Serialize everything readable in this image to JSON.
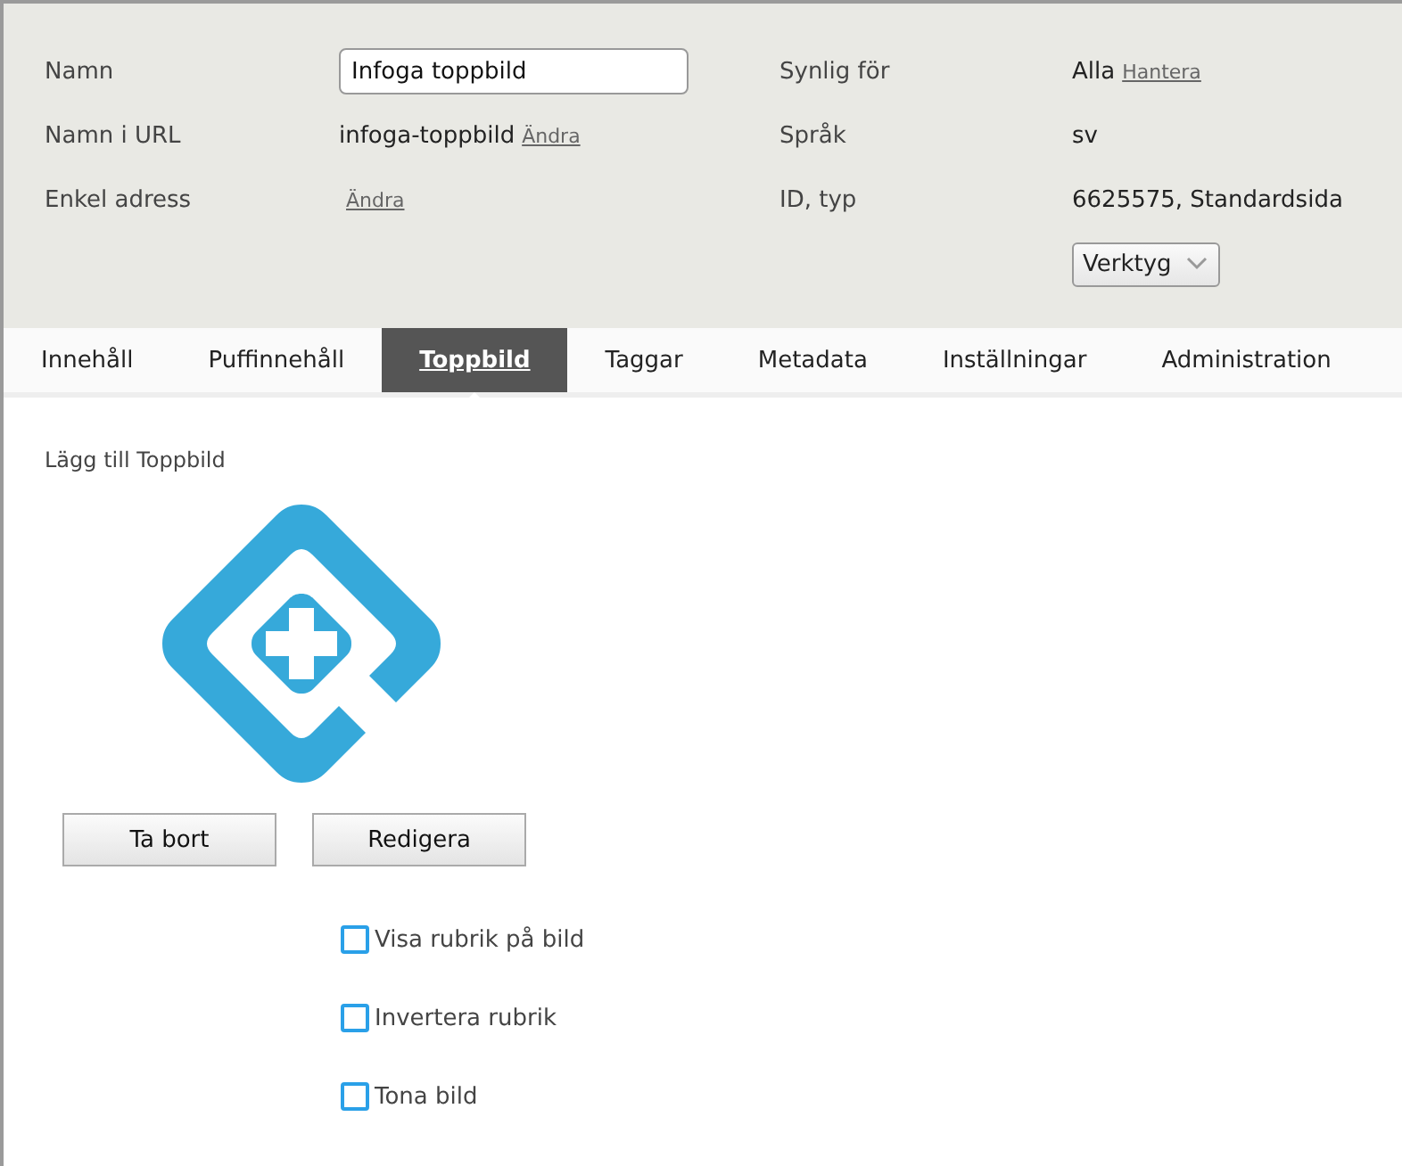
{
  "properties": {
    "left": [
      {
        "label": "Namn",
        "kind": "input",
        "value": "Infoga toppbild"
      },
      {
        "label": "Namn i URL",
        "kind": "text",
        "value": "infoga-toppbild",
        "link": "Ändra"
      },
      {
        "label": "Enkel adress",
        "kind": "link",
        "link": "Ändra"
      }
    ],
    "right": [
      {
        "label": "Synlig för",
        "kind": "text",
        "value": "Alla",
        "link": "Hantera"
      },
      {
        "label": "Språk",
        "kind": "text",
        "value": "sv"
      },
      {
        "label": "ID, typ",
        "kind": "text",
        "value": "6625575, Standardsida"
      }
    ],
    "tools_dropdown": {
      "value": "Verktyg"
    }
  },
  "tabs": [
    {
      "label": "Innehåll",
      "selected": false
    },
    {
      "label": "Puffinnehåll",
      "selected": false
    },
    {
      "label": "Toppbild",
      "selected": true
    },
    {
      "label": "Taggar",
      "selected": false
    },
    {
      "label": "Metadata",
      "selected": false
    },
    {
      "label": "Inställningar",
      "selected": false
    },
    {
      "label": "Administration",
      "selected": false
    }
  ],
  "content": {
    "heading": "Lägg till Toppbild",
    "buttons": [
      "Ta bort",
      "Redigera"
    ],
    "options": [
      {
        "label": "Visa rubrik på bild",
        "checked": false
      },
      {
        "label": "Invertera rubrik",
        "checked": false
      },
      {
        "label": "Tona bild",
        "checked": false
      }
    ]
  }
}
